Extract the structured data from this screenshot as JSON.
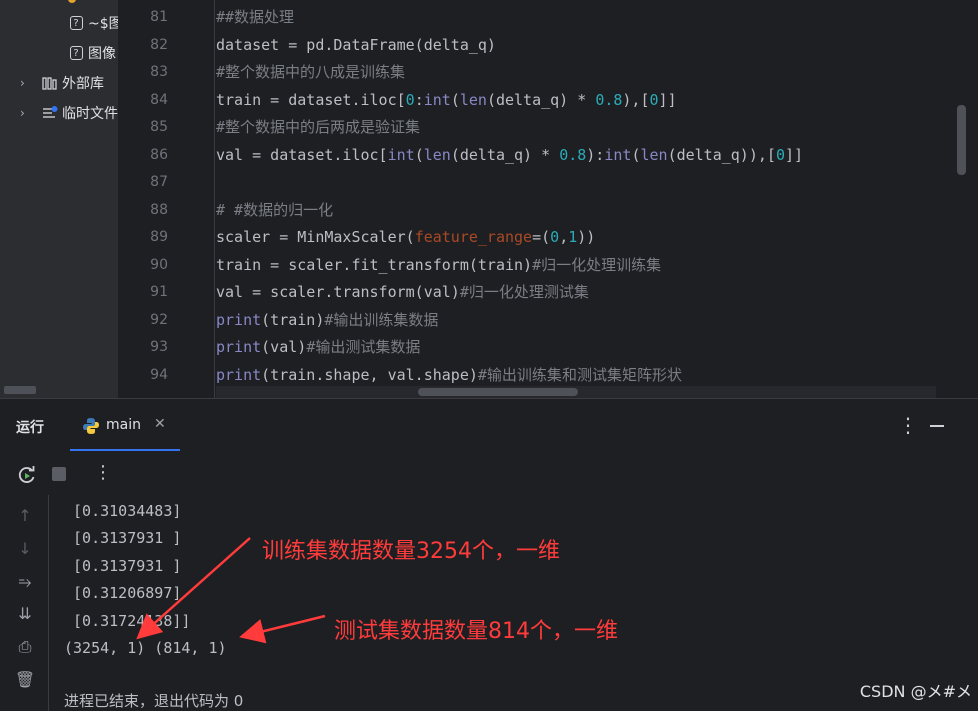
{
  "project_tree": {
    "items": [
      {
        "label": "~$图",
        "icon": "unknown-file-icon",
        "expandable": false
      },
      {
        "label": "图像",
        "icon": "unknown-file-icon",
        "expandable": false
      },
      {
        "label": "外部库",
        "icon": "library-icon",
        "expandable": true
      },
      {
        "label": "临时文件",
        "icon": "scratches-icon",
        "expandable": true
      }
    ]
  },
  "editor": {
    "line_numbers": [
      "81",
      "82",
      "83",
      "84",
      "85",
      "86",
      "87",
      "88",
      "89",
      "90",
      "91",
      "92",
      "93",
      "94"
    ],
    "lines": [
      "##数据处理",
      "dataset = pd.DataFrame(delta_q)",
      "#整个数据中的八成是训练集",
      "train = dataset.iloc[0:int(len(delta_q) * 0.8),[0]]",
      "#整个数据中的后两成是验证集",
      "val = dataset.iloc[int(len(delta_q) * 0.8):int(len(delta_q)),[0]]",
      "",
      "# #数据的归一化",
      "scaler = MinMaxScaler(feature_range=(0,1))",
      "train = scaler.fit_transform(train)#归一化处理训练集",
      "val = scaler.transform(val)#归一化处理测试集",
      "print(train)#输出训练集数据",
      "print(val)#输出测试集数据",
      "print(train.shape, val.shape)#输出训练集和测试集矩阵形状"
    ]
  },
  "run_window": {
    "title": "运行",
    "tab_label": "main",
    "output": [
      " [0.31034483]",
      " [0.3137931 ]",
      " [0.3137931 ]",
      " [0.31206897]",
      " [0.31724138]]",
      "(3254, 1) (814, 1)",
      "",
      "进程已结束，退出代码为 0"
    ]
  },
  "annotations": {
    "train_note": "训练集数据数量3254个，一维",
    "test_note": "测试集数据数量814个，一维",
    "color": "#ff3b3b"
  },
  "watermark": "CSDN @メ#メ"
}
